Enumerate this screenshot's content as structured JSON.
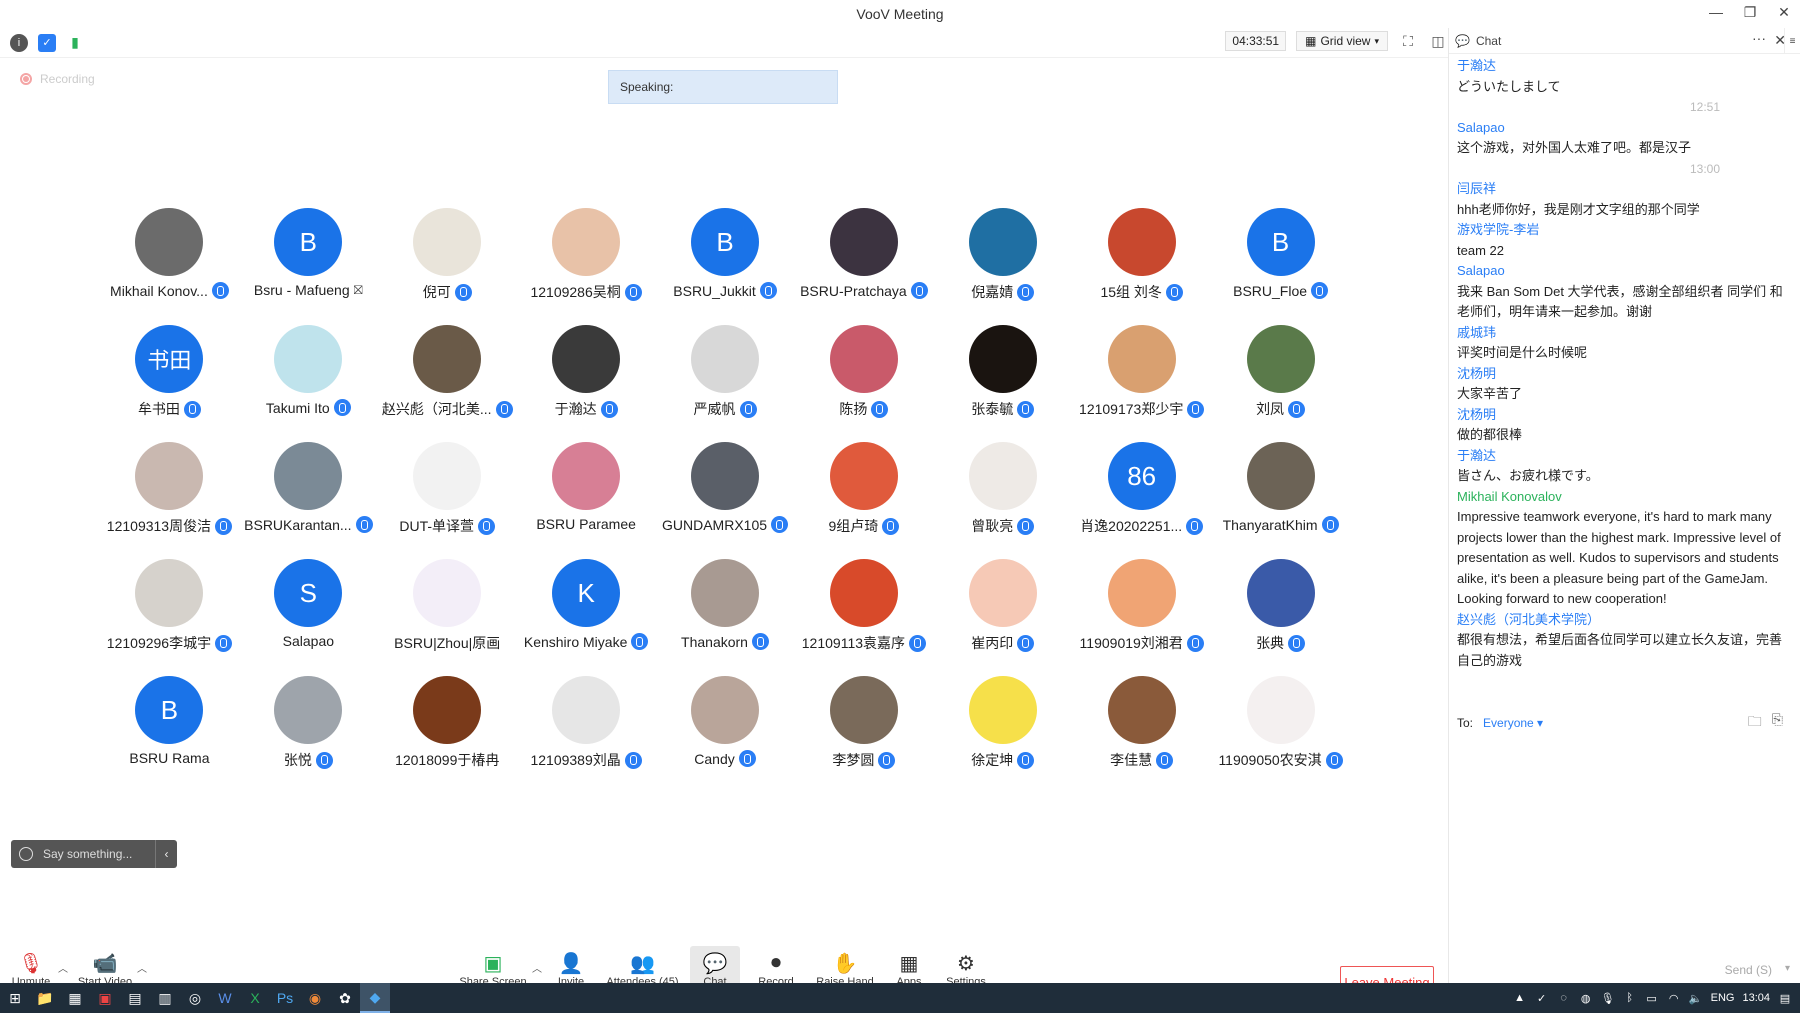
{
  "window": {
    "title": "VooV Meeting",
    "controls": [
      "—",
      "❐",
      "✕"
    ]
  },
  "topbar": {
    "timer": "04:33:51",
    "view_label": "Grid view"
  },
  "recording_label": "Recording",
  "speaking_label": "Speaking:",
  "participants": [
    [
      {
        "name": "Mikhail Konov...",
        "avatar_letter": "",
        "avatar_color": "#6b6b6b",
        "icon": "mic-icon"
      },
      {
        "name": "Bsru - Mafueng",
        "avatar_letter": "B",
        "avatar_color": "#1a73e8",
        "icon": "camera-off-icon"
      },
      {
        "name": "倪可",
        "avatar_letter": "",
        "avatar_color": "#e9e4da",
        "icon": "mic-icon"
      },
      {
        "name": "12109286吴桐",
        "avatar_letter": "",
        "avatar_color": "#e8c2a8",
        "icon": "mic-icon"
      },
      {
        "name": "BSRU_Jukkit",
        "avatar_letter": "B",
        "avatar_color": "#1a73e8",
        "icon": "mic-icon"
      },
      {
        "name": "BSRU-Pratchaya",
        "avatar_letter": "",
        "avatar_color": "#3c3340",
        "icon": "mic-icon"
      },
      {
        "name": "倪嘉婧",
        "avatar_letter": "",
        "avatar_color": "#1f6fa3",
        "icon": "mic-icon"
      },
      {
        "name": "15组 刘冬",
        "avatar_letter": "",
        "avatar_color": "#c8482e",
        "icon": "mic-icon"
      },
      {
        "name": "BSRU_Floe",
        "avatar_letter": "B",
        "avatar_color": "#1a73e8",
        "icon": "mic-icon"
      }
    ],
    [
      {
        "name": "牟书田",
        "avatar_letter": "书田",
        "avatar_color": "#1a73e8",
        "icon": "mic-icon"
      },
      {
        "name": "Takumi Ito",
        "avatar_letter": "",
        "avatar_color": "#bfe3ec",
        "icon": "mic-icon"
      },
      {
        "name": "赵兴彪（河北美...",
        "avatar_letter": "",
        "avatar_color": "#6a5a48",
        "icon": "mic-icon"
      },
      {
        "name": "于瀚达",
        "avatar_letter": "",
        "avatar_color": "#3a3a3a",
        "icon": "mic-icon"
      },
      {
        "name": "严威帆",
        "avatar_letter": "",
        "avatar_color": "#d8d8d8",
        "icon": "mic-icon"
      },
      {
        "name": "陈扬",
        "avatar_letter": "",
        "avatar_color": "#c95a6a",
        "icon": "mic-icon"
      },
      {
        "name": "张泰毓",
        "avatar_letter": "",
        "avatar_color": "#1a1410",
        "icon": "mic-icon"
      },
      {
        "name": "12109173郑少宇",
        "avatar_letter": "",
        "avatar_color": "#d9a070",
        "icon": "mic-icon"
      },
      {
        "name": "刘凤",
        "avatar_letter": "",
        "avatar_color": "#5a7a4a",
        "icon": "mic-icon"
      }
    ],
    [
      {
        "name": "12109313周俊洁",
        "avatar_letter": "",
        "avatar_color": "#c9b8b0",
        "icon": "mic-icon"
      },
      {
        "name": "BSRUKarantan...",
        "avatar_letter": "",
        "avatar_color": "#7b8a96",
        "icon": "mic-icon"
      },
      {
        "name": "DUT-单译萱",
        "avatar_letter": "",
        "avatar_color": "#f2f2f2",
        "icon": "mic-icon"
      },
      {
        "name": "BSRU Paramee",
        "avatar_letter": "",
        "avatar_color": "#d77f95",
        "icon": "none"
      },
      {
        "name": "GUNDAMRX105",
        "avatar_letter": "",
        "avatar_color": "#5a5f68",
        "icon": "mic-icon"
      },
      {
        "name": "9组卢琦",
        "avatar_letter": "",
        "avatar_color": "#e05a3c",
        "icon": "mic-icon"
      },
      {
        "name": "曾耿亮",
        "avatar_letter": "",
        "avatar_color": "#eeeae6",
        "icon": "mic-icon"
      },
      {
        "name": "肖逸20202251...",
        "avatar_letter": "86",
        "avatar_color": "#1a73e8",
        "icon": "mic-icon"
      },
      {
        "name": "ThanyaratKhim",
        "avatar_letter": "",
        "avatar_color": "#6c6356",
        "icon": "mic-icon"
      }
    ],
    [
      {
        "name": "12109296李城宇",
        "avatar_letter": "",
        "avatar_color": "#d6d2cc",
        "icon": "mic-icon"
      },
      {
        "name": "Salapao",
        "avatar_letter": "S",
        "avatar_color": "#1a73e8",
        "icon": "none"
      },
      {
        "name": "BSRU|Zhou|原画",
        "avatar_letter": "",
        "avatar_color": "#f3eef8",
        "icon": "none"
      },
      {
        "name": "Kenshiro Miyake",
        "avatar_letter": "K",
        "avatar_color": "#1a73e8",
        "icon": "mic-icon"
      },
      {
        "name": "Thanakorn",
        "avatar_letter": "",
        "avatar_color": "#a89a92",
        "icon": "mic-icon"
      },
      {
        "name": "12109113袁嘉序",
        "avatar_letter": "",
        "avatar_color": "#d84a2a",
        "icon": "mic-icon"
      },
      {
        "name": "崔丙印",
        "avatar_letter": "",
        "avatar_color": "#f6c9b6",
        "icon": "mic-icon"
      },
      {
        "name": "11909019刘湘君",
        "avatar_letter": "",
        "avatar_color": "#f0a474",
        "icon": "mic-icon"
      },
      {
        "name": "张典",
        "avatar_letter": "",
        "avatar_color": "#3a5aa8",
        "icon": "mic-icon"
      }
    ],
    [
      {
        "name": "BSRU Rama",
        "avatar_letter": "B",
        "avatar_color": "#1a73e8",
        "icon": "none"
      },
      {
        "name": "张悦",
        "avatar_letter": "",
        "avatar_color": "#9ea4ab",
        "icon": "mic-icon"
      },
      {
        "name": "12018099于椿冉",
        "avatar_letter": "",
        "avatar_color": "#7a3a1a",
        "icon": "none"
      },
      {
        "name": "12109389刘晶",
        "avatar_letter": "",
        "avatar_color": "#e6e6e6",
        "icon": "mic-icon"
      },
      {
        "name": "Candy",
        "avatar_letter": "",
        "avatar_color": "#b9a59a",
        "icon": "mic-icon"
      },
      {
        "name": "李梦圆",
        "avatar_letter": "",
        "avatar_color": "#7a6a5a",
        "icon": "mic-icon"
      },
      {
        "name": "徐定坤",
        "avatar_letter": "",
        "avatar_color": "#f6e04a",
        "icon": "mic-icon"
      },
      {
        "name": "李佳慧",
        "avatar_letter": "",
        "avatar_color": "#8a5a3a",
        "icon": "mic-icon"
      },
      {
        "name": "11909050农安淇",
        "avatar_letter": "",
        "avatar_color": "#f4f0f0",
        "icon": "mic-icon"
      }
    ]
  ],
  "say_placeholder": "Say something...",
  "toolbar": {
    "unmute": "Unmute",
    "start_video": "Start Video",
    "share_screen": "Share Screen",
    "invite": "Invite",
    "attendees": "Attendees (45)",
    "chat": "Chat",
    "record": "Record",
    "raise_hand": "Raise Hand",
    "apps": "Apps",
    "settings": "Settings",
    "leave": "Leave Meeting"
  },
  "chat": {
    "title": "Chat",
    "messages": [
      {
        "sender": "于瀚达",
        "text": "どういたしまして",
        "sender_color": "blue"
      },
      {
        "time": "12:51"
      },
      {
        "sender": "Salapao",
        "text": "这个游戏，对外国人太难了吧。都是汉子",
        "sender_color": "blue"
      },
      {
        "time": "13:00"
      },
      {
        "sender": "闫辰祥",
        "text": "hhh老师你好，我是刚才文字组的那个同学",
        "sender_color": "blue"
      },
      {
        "sender": "游戏学院-李岩",
        "text": "team 22",
        "sender_color": "blue"
      },
      {
        "sender": "Salapao",
        "text": "我来 Ban Som Det 大学代表，感谢全部组织者 同学们 和老师们，明年请来一起参加。谢谢",
        "sender_color": "blue"
      },
      {
        "sender": "戚城玮",
        "text": "评奖时间是什么时候呢",
        "sender_color": "blue"
      },
      {
        "sender": "沈杨明",
        "text": "大家辛苦了",
        "sender_color": "blue"
      },
      {
        "sender": "沈杨明",
        "text": "做的都很棒",
        "sender_color": "blue"
      },
      {
        "sender": "于瀚达",
        "text": "皆さん、お疲れ様です。",
        "sender_color": "blue"
      },
      {
        "sender": "Mikhail Konovalov",
        "text": "Impressive teamwork everyone, it's hard to mark many projects lower than the highest mark. Impressive level of presentation as well. Kudos to supervisors and students alike, it's been a pleasure being part of the GameJam. Looking forward to new cooperation!",
        "sender_color": "green"
      },
      {
        "sender": "赵兴彪（河北美术学院）",
        "text": "都很有想法，希望后面各位同学可以建立长久友谊，完善自己的游戏",
        "sender_color": "blue"
      }
    ],
    "to_label": "To:",
    "to_value": "Everyone",
    "send_label": "Send (S)"
  },
  "taskbar": {
    "lang": "ENG",
    "time": "13:04"
  },
  "colors": {
    "accent": "#1a73e8",
    "leave": "#e33"
  }
}
